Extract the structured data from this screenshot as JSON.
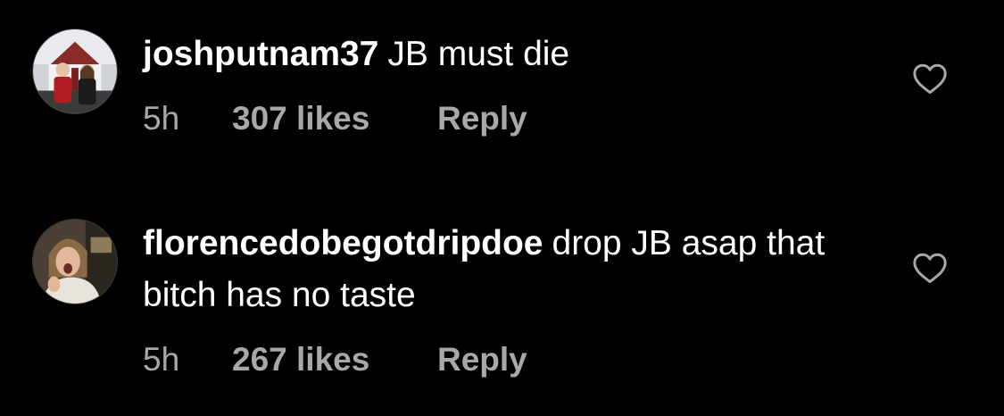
{
  "comments": [
    {
      "username": "joshputnam37",
      "text": "JB must die",
      "time": "5h",
      "likes": "307 likes",
      "reply_label": "Reply",
      "avatar_icon": "profile-photo-couple",
      "like_icon": "heart-outline-icon"
    },
    {
      "username": "florencedobegotdripdoe",
      "text": "drop JB asap that bitch has no taste",
      "time": "5h",
      "likes": "267 likes",
      "reply_label": "Reply",
      "avatar_icon": "profile-photo-person",
      "like_icon": "heart-outline-icon"
    }
  ],
  "colors": {
    "background": "#000000",
    "primary_text": "#ffffff",
    "secondary_text": "#a8a8a8"
  }
}
